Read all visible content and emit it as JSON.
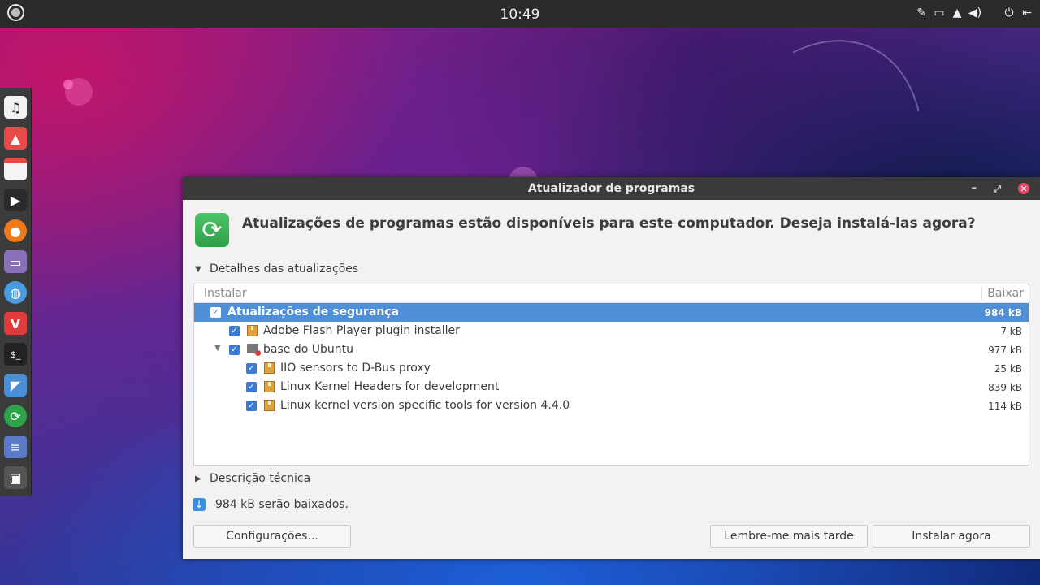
{
  "top_panel": {
    "clock": "10:49",
    "tray_icons": [
      "pin-icon",
      "window-icon",
      "bell-icon",
      "volume-icon",
      "power-icon",
      "logout-icon"
    ]
  },
  "dock": {
    "items": [
      {
        "name": "music-app",
        "glyph": "♫",
        "color": "#f2f2f2"
      },
      {
        "name": "photos-app",
        "glyph": "▲",
        "color": "#e84a4a"
      },
      {
        "name": "calendar-app",
        "glyph": "",
        "color": "#f4f4f4"
      },
      {
        "name": "video-app",
        "glyph": "▶",
        "color": "#2a2a2a"
      },
      {
        "name": "firefox-app",
        "glyph": "●",
        "color": "#f07a1a"
      },
      {
        "name": "files-app",
        "glyph": "▭",
        "color": "#8a70b8"
      },
      {
        "name": "browser-app",
        "glyph": "◍",
        "color": "#4a9be0"
      },
      {
        "name": "vivaldi-app",
        "glyph": "V",
        "color": "#e23b3b"
      },
      {
        "name": "terminal-app",
        "glyph": "$_",
        "color": "#222222"
      },
      {
        "name": "docs-app",
        "glyph": "◤",
        "color": "#4a8fd8"
      },
      {
        "name": "updater-app",
        "glyph": "⟳",
        "color": "#2fa34a"
      },
      {
        "name": "text-editor-app",
        "glyph": "≡",
        "color": "#5b7bc8"
      },
      {
        "name": "screenshot-app",
        "glyph": "▣",
        "color": "#555555"
      }
    ]
  },
  "window": {
    "title": "Atualizador de programas",
    "headline": "Atualizações de programas estão disponíveis para este computador. Deseja instalá-las agora?",
    "details_label": "Detalhes das atualizações",
    "columns": {
      "install": "Instalar",
      "download": "Baixar"
    },
    "rows": [
      {
        "label": "Atualizações de segurança",
        "size": "984 kB",
        "icon": "none"
      },
      {
        "label": "Adobe Flash Player plugin installer",
        "size": "7 kB",
        "icon": "package"
      },
      {
        "label": "base do Ubuntu",
        "size": "977 kB",
        "icon": "system"
      },
      {
        "label": "IIO sensors to D-Bus proxy",
        "size": "25 kB",
        "icon": "package"
      },
      {
        "label": "Linux Kernel Headers for development",
        "size": "839 kB",
        "icon": "package"
      },
      {
        "label": "Linux kernel version specific tools for version 4.4.0",
        "size": "114 kB",
        "icon": "package"
      }
    ],
    "tech_label": "Descrição técnica",
    "download_summary": "984 kB serão baixados.",
    "buttons": {
      "settings": "Configurações...",
      "remind": "Lembre-me mais tarde",
      "install": "Instalar agora"
    }
  }
}
